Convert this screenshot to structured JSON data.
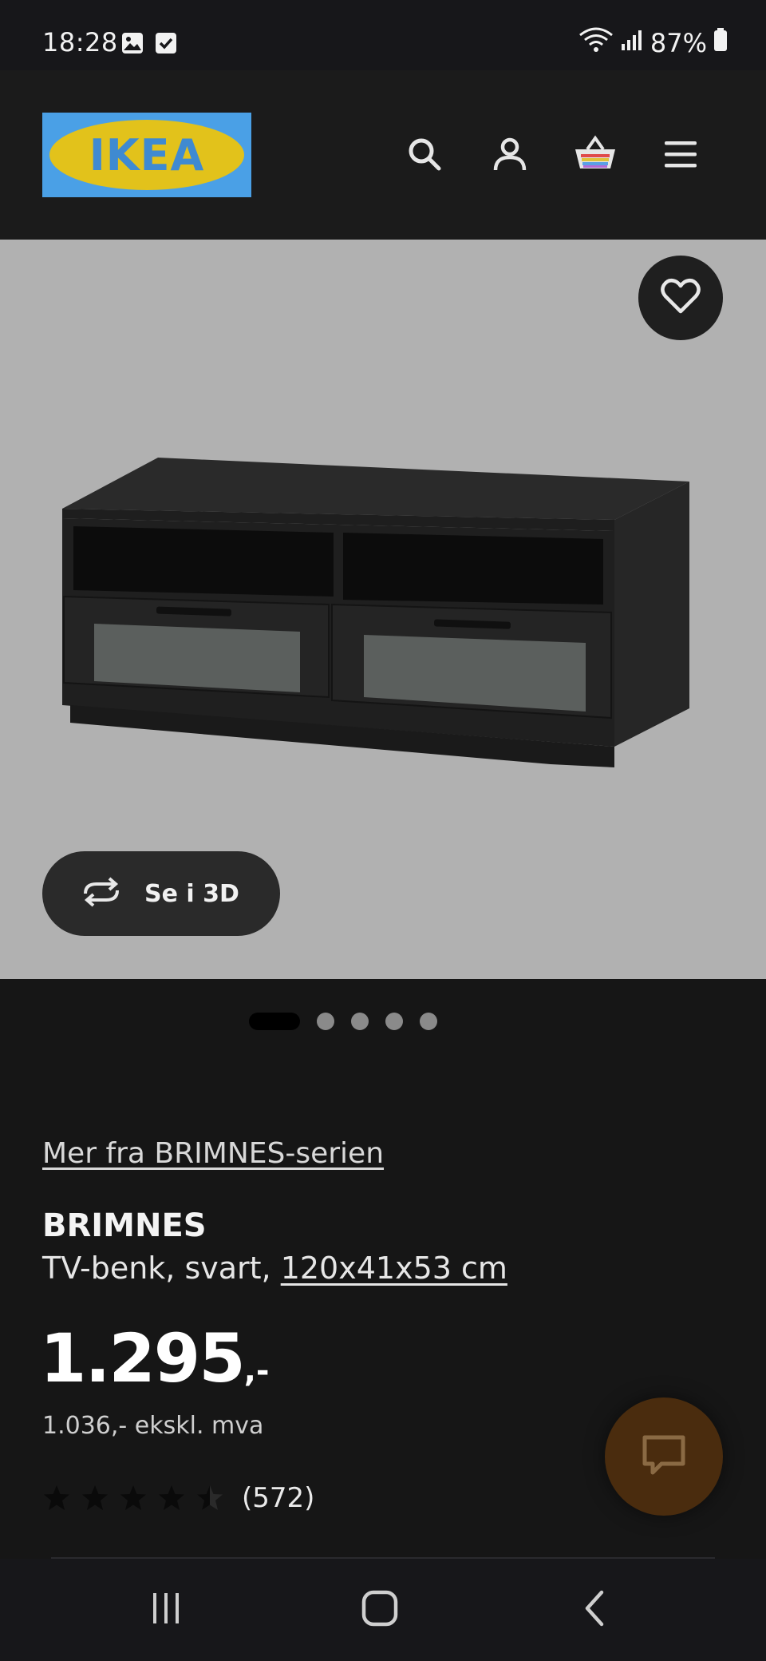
{
  "status_bar": {
    "time": "18:28",
    "battery": "87%",
    "icons": [
      "gallery-icon",
      "check-icon",
      "wifi-icon",
      "signal-icon",
      "battery-icon"
    ]
  },
  "header": {
    "logo_text": "IKEA",
    "icons": [
      "search-icon",
      "account-icon",
      "basket-icon",
      "menu-icon"
    ]
  },
  "hero": {
    "view_3d_label": "Se i 3D",
    "carousel_count": 5,
    "carousel_active": 0
  },
  "product": {
    "series_link": "Mer fra BRIMNES-serien",
    "name": "BRIMNES",
    "description_prefix": "TV-benk, svart, ",
    "dimensions": "120x41x53 cm",
    "price": "1.295",
    "price_suffix": ",-",
    "price_ex_vat": "1.036,- ekskl. mva",
    "rating_value": 4.5,
    "rating_count": "(572)"
  },
  "colors": {
    "background": "#161616",
    "header": "#1b1b1b",
    "hero": "#b1b1b1",
    "logo_blue": "#4aa0e6",
    "logo_yellow": "#e2c21b",
    "chat_fab": "#4a2c0e"
  }
}
